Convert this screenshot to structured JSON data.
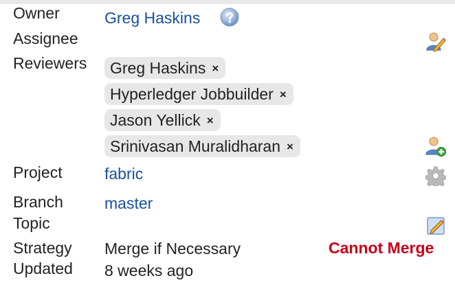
{
  "fields": {
    "owner_label": "Owner",
    "owner_value": "Greg Haskins",
    "assignee_label": "Assignee",
    "reviewers_label": "Reviewers",
    "reviewers": [
      {
        "name": "Greg Haskins",
        "remove": "×"
      },
      {
        "name": "Hyperledger Jobbuilder",
        "remove": "×"
      },
      {
        "name": "Jason Yellick",
        "remove": "×"
      },
      {
        "name": "Srinivasan Muralidharan",
        "remove": "×"
      }
    ],
    "project_label": "Project",
    "project_value": "fabric",
    "branch_label": "Branch",
    "branch_value": "master",
    "topic_label": "Topic",
    "strategy_label": "Strategy",
    "strategy_value": "Merge if Necessary",
    "merge_status": "Cannot Merge",
    "updated_label": "Updated",
    "updated_value": "8 weeks ago"
  },
  "icons": {
    "owner_info": "question-icon",
    "assignee_edit": "edit-assignee-icon",
    "add_reviewer": "add-reviewer-icon",
    "project_settings": "gear-icon",
    "topic_edit": "edit-pencil-icon"
  },
  "colors": {
    "link": "#1a4f9c",
    "chip_bg": "#e7e7e7",
    "cannot_merge": "#c8001a"
  }
}
